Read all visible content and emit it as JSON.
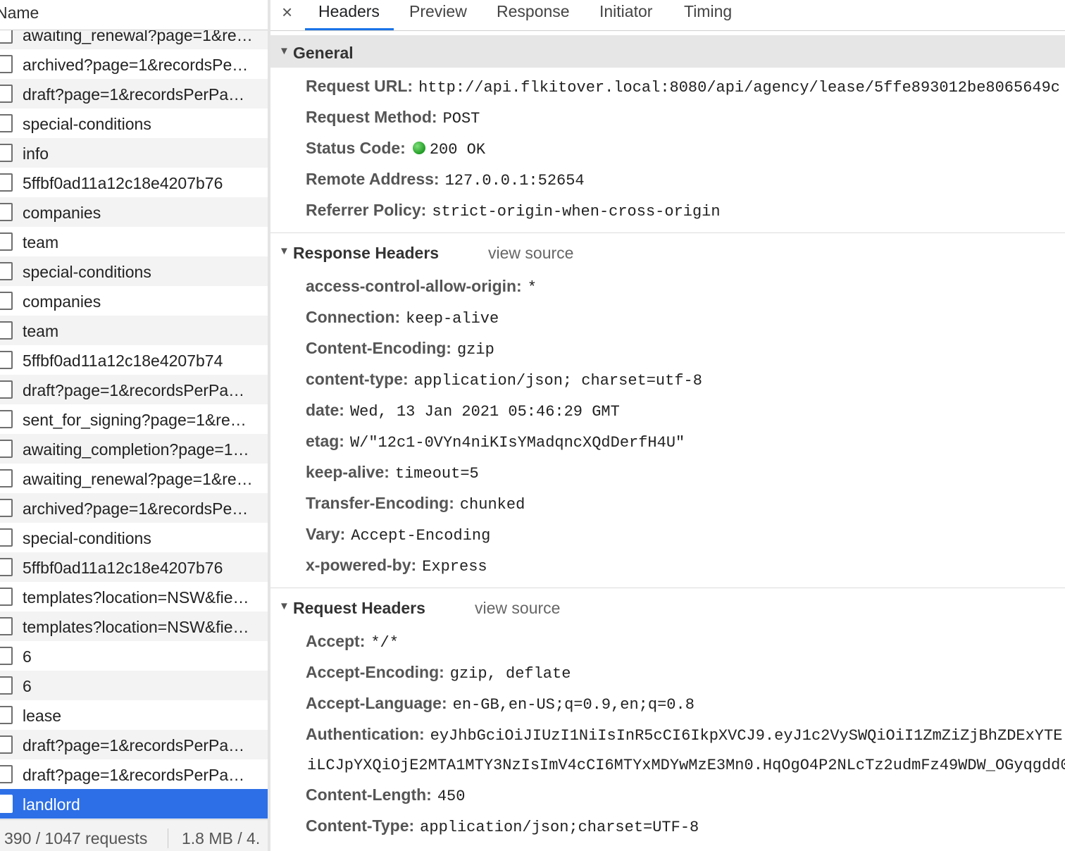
{
  "request_list": {
    "column_header": "Name",
    "rows": [
      {
        "name": "awaiting_renewal?page=1&re…",
        "selected": false
      },
      {
        "name": "archived?page=1&recordsPe…",
        "selected": false
      },
      {
        "name": "draft?page=1&recordsPerPa…",
        "selected": false
      },
      {
        "name": "special-conditions",
        "selected": false
      },
      {
        "name": "info",
        "selected": false
      },
      {
        "name": "5ffbf0ad11a12c18e4207b76",
        "selected": false
      },
      {
        "name": "companies",
        "selected": false
      },
      {
        "name": "team",
        "selected": false
      },
      {
        "name": "special-conditions",
        "selected": false
      },
      {
        "name": "companies",
        "selected": false
      },
      {
        "name": "team",
        "selected": false
      },
      {
        "name": "5ffbf0ad11a12c18e4207b74",
        "selected": false
      },
      {
        "name": "draft?page=1&recordsPerPa…",
        "selected": false
      },
      {
        "name": "sent_for_signing?page=1&re…",
        "selected": false
      },
      {
        "name": "awaiting_completion?page=1…",
        "selected": false
      },
      {
        "name": "awaiting_renewal?page=1&re…",
        "selected": false
      },
      {
        "name": "archived?page=1&recordsPe…",
        "selected": false
      },
      {
        "name": "special-conditions",
        "selected": false
      },
      {
        "name": "5ffbf0ad11a12c18e4207b76",
        "selected": false
      },
      {
        "name": "templates?location=NSW&fie…",
        "selected": false
      },
      {
        "name": "templates?location=NSW&fie…",
        "selected": false
      },
      {
        "name": "6",
        "selected": false
      },
      {
        "name": "6",
        "selected": false
      },
      {
        "name": "lease",
        "selected": false
      },
      {
        "name": "draft?page=1&recordsPerPa…",
        "selected": false
      },
      {
        "name": "draft?page=1&recordsPerPa…",
        "selected": false
      },
      {
        "name": "landlord",
        "selected": true
      }
    ],
    "footer": {
      "requests": "390 / 1047 requests",
      "transferred": "1.8 MB / 4."
    }
  },
  "tabs": {
    "close_icon": "×",
    "items": [
      "Headers",
      "Preview",
      "Response",
      "Initiator",
      "Timing"
    ],
    "active": "Headers"
  },
  "general": {
    "title": "General",
    "request_url_label": "Request URL:",
    "request_url": "http://api.flkitover.local:8080/api/agency/lease/5ffe893012be8065649c",
    "request_method_label": "Request Method:",
    "request_method": "POST",
    "status_code_label": "Status Code:",
    "status_code": "200 OK",
    "status_color": "#1f9b24",
    "remote_address_label": "Remote Address:",
    "remote_address": "127.0.0.1:52654",
    "referrer_policy_label": "Referrer Policy:",
    "referrer_policy": "strict-origin-when-cross-origin"
  },
  "response_headers": {
    "title": "Response Headers",
    "view_source": "view source",
    "items": [
      {
        "key": "access-control-allow-origin:",
        "value": "*"
      },
      {
        "key": "Connection:",
        "value": "keep-alive"
      },
      {
        "key": "Content-Encoding:",
        "value": "gzip"
      },
      {
        "key": "content-type:",
        "value": "application/json; charset=utf-8"
      },
      {
        "key": "date:",
        "value": "Wed, 13 Jan 2021 05:46:29 GMT"
      },
      {
        "key": "etag:",
        "value": "W/\"12c1-0VYn4niKIsYMadqncXQdDerfH4U\""
      },
      {
        "key": "keep-alive:",
        "value": "timeout=5"
      },
      {
        "key": "Transfer-Encoding:",
        "value": "chunked"
      },
      {
        "key": "Vary:",
        "value": "Accept-Encoding"
      },
      {
        "key": "x-powered-by:",
        "value": "Express"
      }
    ]
  },
  "request_headers": {
    "title": "Request Headers",
    "view_source": "view source",
    "accept_label": "Accept:",
    "accept": "*/*",
    "accept_encoding_label": "Accept-Encoding:",
    "accept_encoding": "gzip, deflate",
    "accept_language_label": "Accept-Language:",
    "accept_language": "en-GB,en-US;q=0.9,en;q=0.8",
    "authentication_label": "Authentication:",
    "authentication_line1": "eyJhbGciOiJIUzI1NiIsInR5cCI6IkpXVCJ9.eyJ1c2VySWQiOiI1ZmZiZjBhZDExYTE",
    "authentication_line2": "iLCJpYXQiOjE2MTA1MTY3NzIsImV4cCI6MTYxMDYwMzE3Mn0.HqOgO4P2NLcTz2udmFz49WDW_OGyqgdd0",
    "content_length_label": "Content-Length:",
    "content_length": "450",
    "content_type_label": "Content-Type:",
    "content_type": "application/json;charset=UTF-8"
  }
}
